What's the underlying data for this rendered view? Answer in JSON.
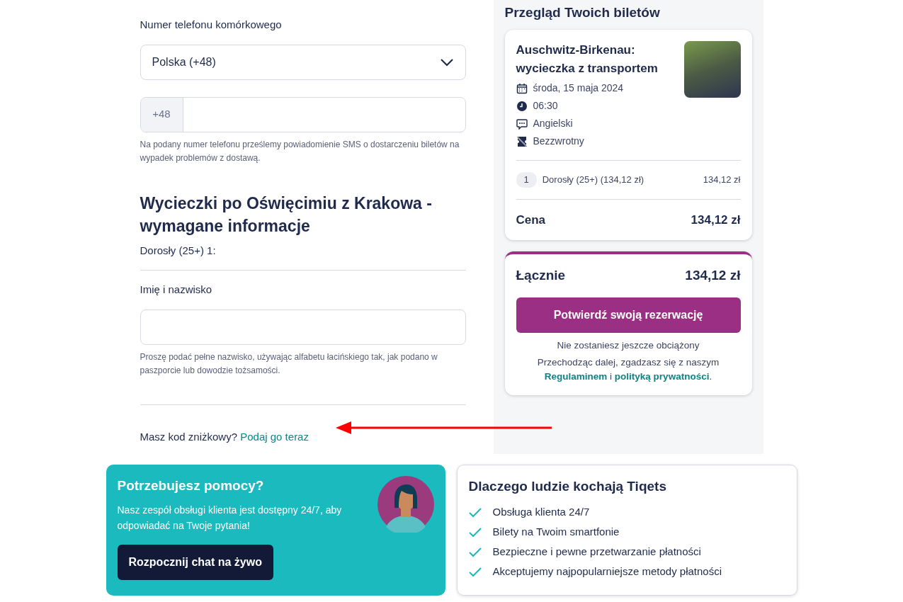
{
  "phone": {
    "label": "Numer telefonu komórkowego",
    "country": "Polska (+48)",
    "prefix": "+48",
    "hint": "Na podany numer telefonu prześlemy powiadomienie SMS o dostarczeniu biletów na wypadek problemów z dostawą."
  },
  "required_info": {
    "title": "Wycieczki po Oświęcimiu z Krakowa - wymagane informacje",
    "traveler": "Dorosły (25+) 1:",
    "name_label": "Imię i nazwisko",
    "name_hint": "Proszę podać pełne nazwisko, używając alfabetu łacińskiego tak, jak podano w paszporcie lub dowodzie tożsamości."
  },
  "discount": {
    "question": "Masz kod zniżkowy?",
    "link": "Podaj go teraz"
  },
  "summary": {
    "title": "Przegląd Twoich biletów",
    "ticket_title": "Auschwitz-Birkenau: wycieczka z transportem",
    "details": [
      {
        "kind": "calendar",
        "text": "środa, 15 maja 2024"
      },
      {
        "kind": "clock",
        "text": "06:30"
      },
      {
        "kind": "language",
        "text": "Angielski"
      },
      {
        "kind": "nonrefundable",
        "text": "Bezzwrotny"
      }
    ],
    "lines": [
      {
        "qty": "1",
        "label": "Dorosły (25+) (134,12 zł)",
        "price": "134,12 zł"
      }
    ],
    "price_label": "Cena",
    "price": "134,12 zł"
  },
  "total": {
    "label": "Łącznie",
    "amount": "134,12 zł",
    "button": "Potwierdź swoją rezerwację",
    "note": "Nie zostaniesz jeszcze obciążony",
    "terms_prefix": "Przechodząc dalej, zgadzasz się z naszym",
    "terms_link": "Regulaminem",
    "terms_join": "i",
    "privacy_link": "polityką prywatności",
    "terms_end": "."
  },
  "help": {
    "title": "Potrzebujesz pomocy?",
    "text": "Nasz zespół obsługi klienta jest dostępny 24/7, aby odpowiadać na Twoje pytania!",
    "button": "Rozpocznij chat na żywo"
  },
  "why": {
    "title": "Dlaczego ludzie kochają Tiqets",
    "items": [
      "Obsługa klienta 24/7",
      "Bilety na Twoim smartfonie",
      "Bezpieczne i pewne przetwarzanie płatności",
      "Akceptujemy najpopularniejsze metody płatności"
    ]
  }
}
